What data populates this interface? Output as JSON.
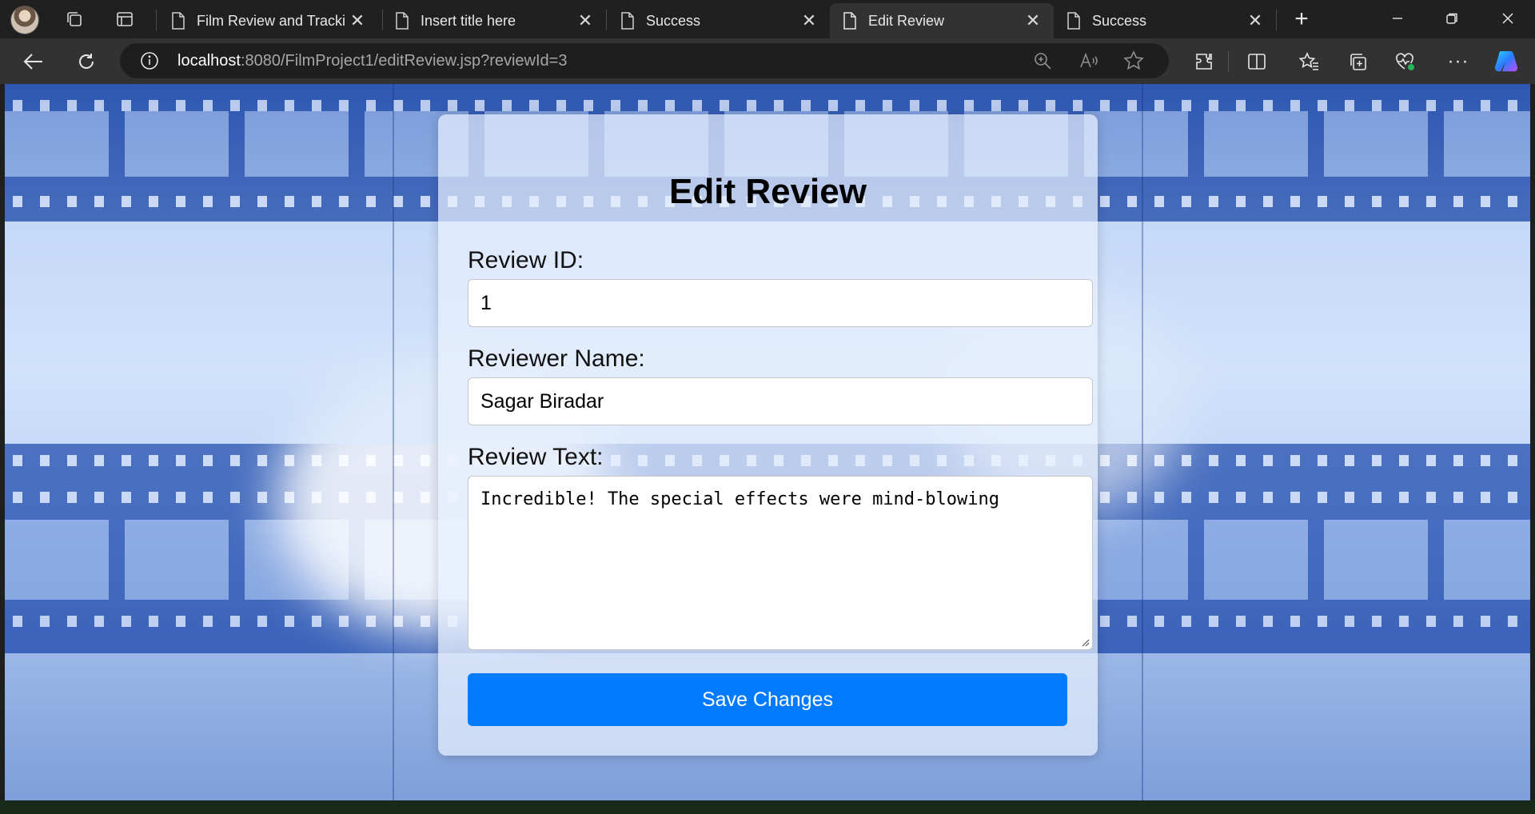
{
  "browser": {
    "tabs": [
      {
        "title": "Film Review and Trackir",
        "icon": "page-icon"
      },
      {
        "title": "Insert title here",
        "icon": "page-icon"
      },
      {
        "title": "Success",
        "icon": "page-icon"
      },
      {
        "title": "Edit Review",
        "icon": "page-icon",
        "active": true
      },
      {
        "title": "Success",
        "icon": "page-icon"
      }
    ],
    "new_tab_label": "+",
    "url_host": "localhost",
    "url_rest": ":8080/FilmProject1/editReview.jsp?reviewId=3"
  },
  "form": {
    "heading": "Edit Review",
    "review_id_label": "Review ID:",
    "review_id_value": "1",
    "reviewer_name_label": "Reviewer Name:",
    "reviewer_name_value": "Sagar Biradar",
    "review_text_label": "Review Text:",
    "review_text_value": "Incredible! The special effects were mind-blowing",
    "save_label": "Save Changes"
  },
  "colors": {
    "accent": "#007bff",
    "tabbar": "#202020",
    "toolbar": "#323232"
  }
}
